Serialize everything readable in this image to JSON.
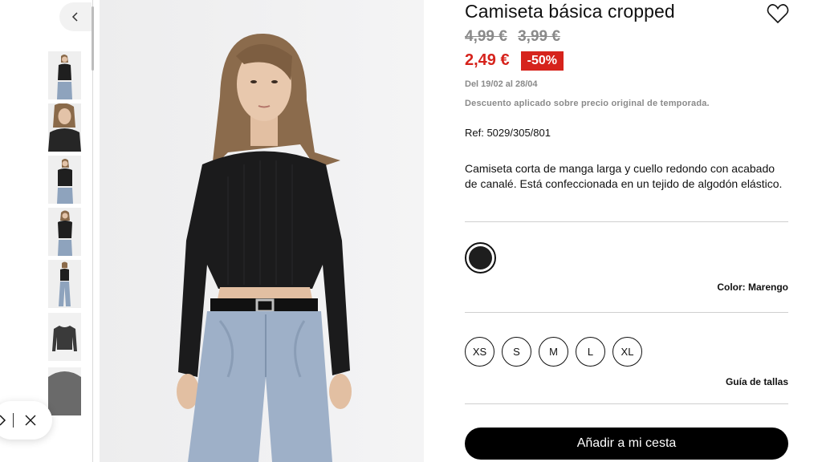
{
  "product": {
    "title": "Camiseta básica cropped",
    "old_price_1": "4,99 €",
    "old_price_2": "3,99 €",
    "price": "2,49 €",
    "discount_badge": "-50%",
    "dates": "Del 19/02 al 28/04",
    "discount_note": "Descuento aplicado sobre precio original de temporada.",
    "ref": "Ref: 5029/305/801",
    "description": "Camiseta corta de manga larga y cuello redondo con acabado de canalé. Está confeccionada en un tejido de algodón elástico.",
    "color_label": "Color: Marengo",
    "sizes": [
      "XS",
      "S",
      "M",
      "L",
      "XL"
    ],
    "size_guide": "Guía de tallas",
    "cart_button": "Añadir a mi cesta"
  },
  "colors": {
    "sale_red": "#d6231c",
    "muted_grey": "#8a8a8a",
    "swatch": "#1e1e1e"
  },
  "icons": {
    "back": "chevron-left-icon",
    "favorite": "heart-outline-icon",
    "close": "close-icon"
  }
}
